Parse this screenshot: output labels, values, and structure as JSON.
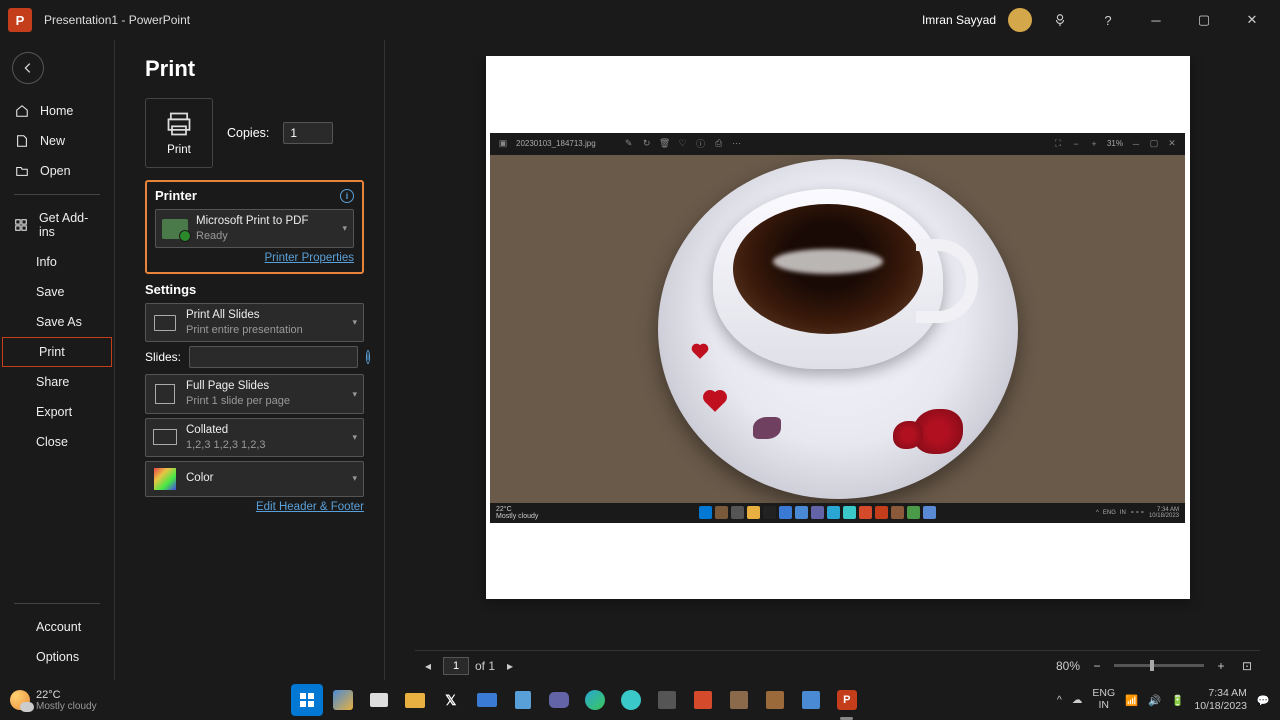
{
  "titlebar": {
    "doc_title": "Presentation1",
    "app_name": "PowerPoint",
    "full_title": "Presentation1 - PowerPoint",
    "user": "Imran Sayyad"
  },
  "nav": {
    "home": "Home",
    "new": "New",
    "open": "Open",
    "addins": "Get Add-ins",
    "info": "Info",
    "save": "Save",
    "saveas": "Save As",
    "print": "Print",
    "share": "Share",
    "export": "Export",
    "close": "Close",
    "account": "Account",
    "options": "Options"
  },
  "print_panel": {
    "heading": "Print",
    "print_btn": "Print",
    "copies_label": "Copies:",
    "copies_value": "1",
    "printer_heading": "Printer",
    "printer_name": "Microsoft Print to PDF",
    "printer_status": "Ready",
    "printer_props": "Printer Properties",
    "settings_heading": "Settings",
    "range_title": "Print All Slides",
    "range_sub": "Print entire presentation",
    "slides_label": "Slides:",
    "layout_title": "Full Page Slides",
    "layout_sub": "Print 1 slide per page",
    "collate_title": "Collated",
    "collate_sub": "1,2,3    1,2,3    1,2,3",
    "color_title": "Color",
    "edit_hf": "Edit Header & Footer"
  },
  "preview": {
    "page_current": "1",
    "page_total": "of 1",
    "zoom": "80%",
    "embedded": {
      "filename": "20230103_184713.jpg",
      "zoom": "31%",
      "temp": "22°C",
      "weather": "Mostly cloudy",
      "lang": "ENG",
      "region": "IN",
      "time": "7:34 AM",
      "date": "10/18/2023"
    }
  },
  "taskbar": {
    "temp": "22°C",
    "weather": "Mostly cloudy",
    "lang1": "ENG",
    "lang2": "IN",
    "time": "7:34 AM",
    "date": "10/18/2023"
  }
}
